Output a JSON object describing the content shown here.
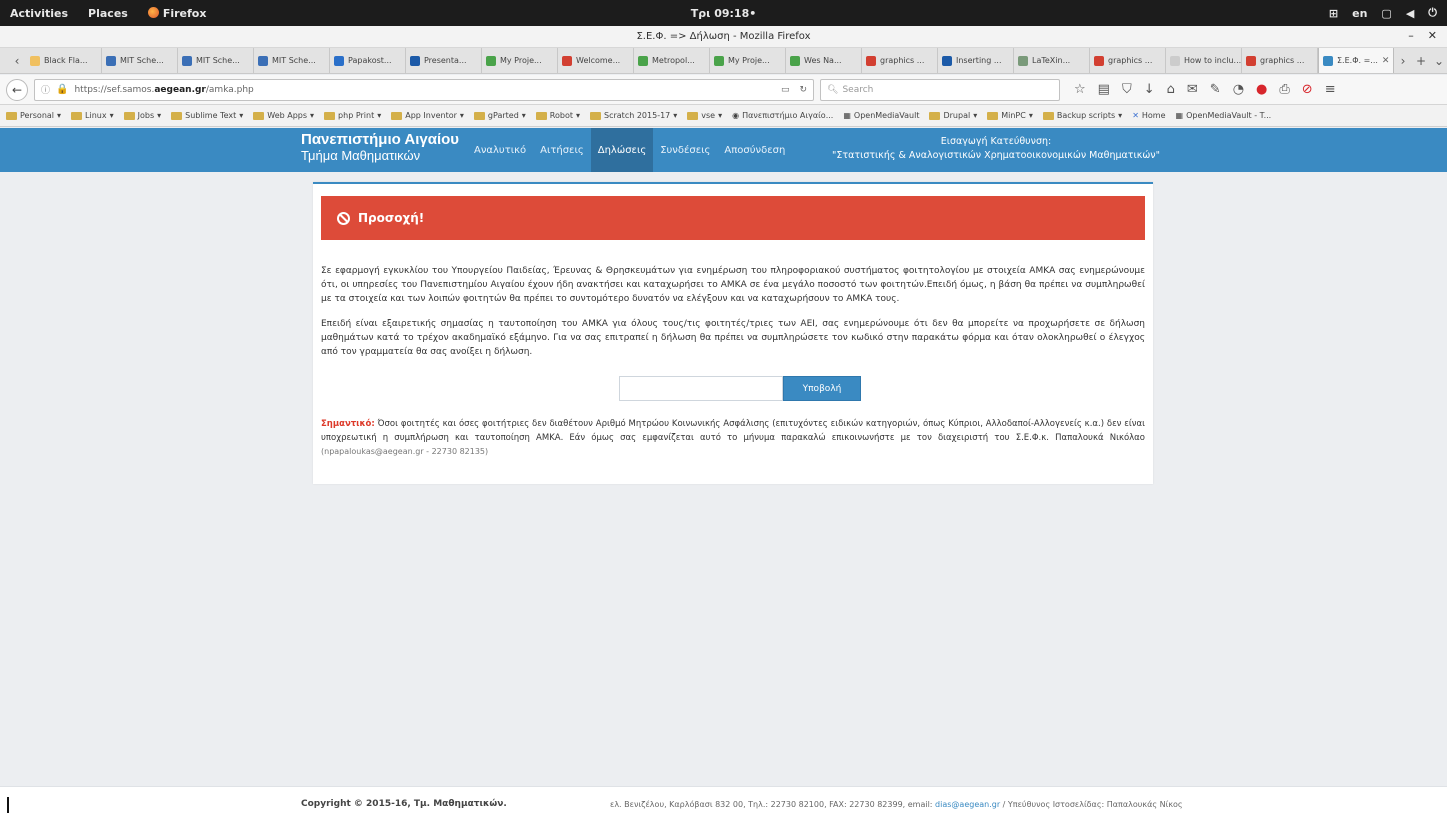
{
  "gnome": {
    "activities": "Activities",
    "places": "Places",
    "app": "Firefox",
    "clock": "Τρι 09:18•",
    "lang": "en"
  },
  "window": {
    "title": "Σ.Ε.Φ. => Δήλωση - Mozilla Firefox"
  },
  "tabs": [
    {
      "label": "Black Fla...",
      "color": "#f0c060"
    },
    {
      "label": "MIT Sche...",
      "color": "#3b6fb6"
    },
    {
      "label": "MIT Sche...",
      "color": "#3b6fb6"
    },
    {
      "label": "MIT Sche...",
      "color": "#3b6fb6"
    },
    {
      "label": "Papakost...",
      "color": "#2a6fc9"
    },
    {
      "label": "Presenta...",
      "color": "#1c5aa8"
    },
    {
      "label": "My Proje...",
      "color": "#4aa34a"
    },
    {
      "label": "Welcome...",
      "color": "#d23f31"
    },
    {
      "label": "Metropol...",
      "color": "#4aa34a"
    },
    {
      "label": "My Proje...",
      "color": "#4aa34a"
    },
    {
      "label": "Wes Na...",
      "color": "#4aa34a"
    },
    {
      "label": "graphics ...",
      "color": "#d23f31"
    },
    {
      "label": "Inserting ...",
      "color": "#1c5aa8"
    },
    {
      "label": "LaTeXin...",
      "color": "#7a9a7a"
    },
    {
      "label": "graphics ...",
      "color": "#d23f31"
    },
    {
      "label": "How to inclu...",
      "color": "#cccccc"
    },
    {
      "label": "graphics ...",
      "color": "#d23f31"
    },
    {
      "label": "Σ.Ε.Φ. =...",
      "color": "#3a8ac2"
    }
  ],
  "nav": {
    "url_prefix": "https://sef.samos.",
    "url_domain": "aegean.gr",
    "url_path": "/amka.php",
    "search_placeholder": "Search"
  },
  "bookmarks": [
    {
      "label": "Personal",
      "type": "folder"
    },
    {
      "label": "Linux",
      "type": "folder"
    },
    {
      "label": "Jobs",
      "type": "folder"
    },
    {
      "label": "Sublime Text",
      "type": "folder"
    },
    {
      "label": "Web Apps",
      "type": "folder"
    },
    {
      "label": "php Print",
      "type": "folder"
    },
    {
      "label": "App Inventor",
      "type": "folder"
    },
    {
      "label": "gParted",
      "type": "folder"
    },
    {
      "label": "Robot",
      "type": "folder"
    },
    {
      "label": "Scratch 2015-17",
      "type": "folder"
    },
    {
      "label": "vse",
      "type": "folder"
    },
    {
      "label": "Πανεπιστήμιο Αιγαίο...",
      "type": "link"
    },
    {
      "label": "OpenMediaVault",
      "type": "link"
    },
    {
      "label": "Drupal",
      "type": "folder"
    },
    {
      "label": "MinPC",
      "type": "folder"
    },
    {
      "label": "Backup scripts",
      "type": "folder"
    },
    {
      "label": "Home",
      "type": "link"
    },
    {
      "label": "OpenMediaVault - T...",
      "type": "link"
    }
  ],
  "site": {
    "brand_line1": "Πανεπιστήμιο Αιγαίου",
    "brand_line2": "Τμήμα Μαθηματικών",
    "menu": [
      {
        "label": "Αναλυτικό",
        "active": false
      },
      {
        "label": "Αιτήσεις",
        "active": false
      },
      {
        "label": "Δηλώσεις",
        "active": true
      },
      {
        "label": "Συνδέσεις",
        "active": false
      },
      {
        "label": "Αποσύνδεση",
        "active": false
      }
    ],
    "headnote_line1": "Εισαγωγή Κατεύθυνση:",
    "headnote_line2": "\"Στατιστικής & Αναλογιστικών Χρηματοοικονομικών Μαθηματικών\""
  },
  "alert": {
    "title": "Προσοχή!",
    "color": "#dd4b39"
  },
  "content": {
    "paragraph1": "Σε εφαρμογή εγκυκλίου του Υπουργείου Παιδείας, Έρευνας & Θρησκευμάτων για ενημέρωση του πληροφοριακού συστήματος φοιτητολογίου με στοιχεία ΑΜΚΑ σας ενημερώνουμε ότι, οι υπηρεσίες του Πανεπιστημίου Αιγαίου έχουν ήδη ανακτήσει και καταχωρήσει το ΑΜΚΑ σε ένα μεγάλο ποσοστό των φοιτητών.Επειδή όμως, η βάση θα πρέπει να συμπληρωθεί με τα στοιχεία και των λοιπών φοιτητών θα πρέπει το συντομότερο δυνατόν να ελέγξουν και να καταχωρήσουν το ΑΜΚΑ τους.",
    "paragraph2": "Επειδή είναι εξαιρετικής σημασίας η ταυτοποίηση του ΑΜΚΑ για όλους τους/τις φοιτητές/τριες των ΑΕΙ, σας ενημερώνουμε ότι δεν θα μπορείτε να προχωρήσετε σε δήλωση μαθημάτων κατά το τρέχον ακαδημαϊκό εξάμηνο. Για να σας επιτραπεί η δήλωση θα πρέπει να συμπληρώσετε τον κωδικό στην παρακάτω φόρμα και όταν ολοκληρωθεί ο έλεγχος από τον γραμματεία θα σας ανοίξει η δήλωση.",
    "input_value": "",
    "submit_label": "Υποβολή",
    "note_label": "Σημαντικό:",
    "note_text": " Όσοι φοιτητές και όσες φοιτήτριες δεν διαθέτουν Αριθμό Μητρώου Κοινωνικής Ασφάλισης (επιτυχόντες ειδικών κατηγοριών, όπως Κύπριοι, Αλλοδαποί-Αλλογενείς κ.α.) δεν είναι υποχρεωτική η συμπλήρωση και ταυτοποίηση ΑΜΚΑ. Εάν όμως σας εμφανίζεται αυτό το μήνυμα παρακαλώ επικοινωνήστε με τον διαχειριστή του Σ.Ε.Φ.κ. Παπαλουκά Νικόλαο",
    "note_contact": " (npapaloukas@aegean.gr - 22730 82135)"
  },
  "footer": {
    "copyright": "Copyright © 2015-16, Τμ. Μαθηματικών.",
    "address_text": "ελ. Βενιζέλου, Καρλόβασι 832 00, Τηλ.: 22730 82100, FAX: 22730 82399, email: ",
    "email": "dias@aegean.gr",
    "responsible": " / Υπεύθυνος Ιστοσελίδας: Παπαλουκάς Νίκος"
  }
}
